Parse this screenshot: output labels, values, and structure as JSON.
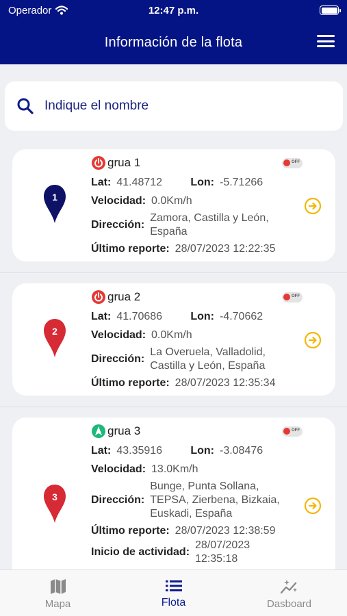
{
  "status_bar": {
    "carrier": "Operador",
    "time": "12:47 p.m."
  },
  "header": {
    "title": "Información de la flota"
  },
  "search": {
    "placeholder": "Indique el nombre"
  },
  "labels": {
    "lat": "Lat:",
    "lon": "Lon:",
    "speed": "Velocidad:",
    "address": "Dirección:",
    "last_report": "Último reporte:",
    "activity_start": "Inicio de actividad:",
    "toggle_off": "OFF"
  },
  "vehicles": [
    {
      "pin_number": "1",
      "pin_color": "#0d1266",
      "status": "off",
      "status_color": "#e53935",
      "name": "grua 1",
      "lat": "41.48712",
      "lon": "-5.71266",
      "speed": "0.0Km/h",
      "address_lines": [
        "Zamora, Castilla y León,",
        "España"
      ],
      "last_report": "28/07/2023 12:22:35"
    },
    {
      "pin_number": "2",
      "pin_color": "#d62a34",
      "status": "off",
      "status_color": "#e53935",
      "name": "grua 2",
      "lat": "41.70686",
      "lon": "-4.70662",
      "speed": "0.0Km/h",
      "address_lines": [
        "La Overuela, Valladolid,",
        "Castilla y León, España"
      ],
      "last_report": "28/07/2023 12:35:34"
    },
    {
      "pin_number": "3",
      "pin_color": "#d62a34",
      "status": "navigating",
      "status_color": "#1db87b",
      "name": "grua 3",
      "lat": "43.35916",
      "lon": "-3.08476",
      "speed": "13.0Km/h",
      "address_lines": [
        "Bunge, Punta Sollana,",
        "TEPSA, Zierbena, Bizkaia,",
        "Euskadi, España"
      ],
      "last_report": "28/07/2023 12:38:59",
      "activity_start_lines": [
        "28/07/2023",
        "12:35:18"
      ]
    }
  ],
  "tabs": [
    {
      "label": "Mapa",
      "icon": "map-icon",
      "active": false
    },
    {
      "label": "Flota",
      "icon": "list-icon",
      "active": true
    },
    {
      "label": "Dasboard",
      "icon": "chart-sparkle-icon",
      "active": false
    }
  ],
  "colors": {
    "header": "#051484",
    "accent_arrow": "#f2b705",
    "active_tab": "#0d1b8c"
  }
}
